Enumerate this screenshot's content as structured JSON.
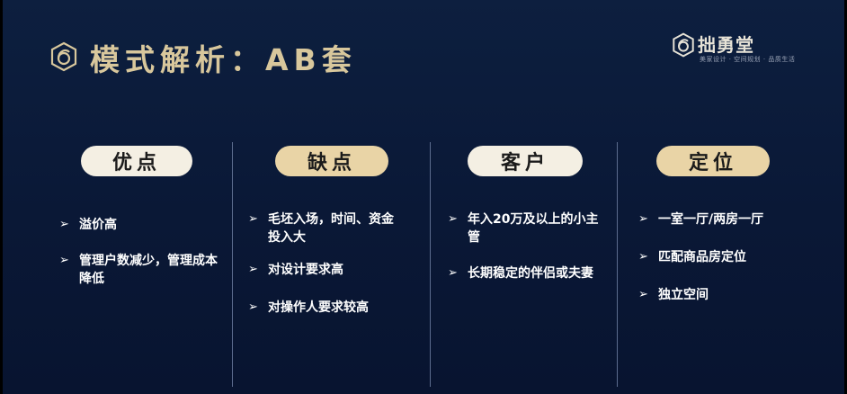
{
  "header": {
    "title": "模式解析：AB套",
    "brand_name": "拙勇堂",
    "brand_tagline": "美家设计 · 空间规划 · 品质生活"
  },
  "bullet_glyph": "➢",
  "columns": [
    {
      "heading": "优点",
      "items": [
        "溢价高",
        "管理户数减少，管理成本降低"
      ]
    },
    {
      "heading": "缺点",
      "items": [
        "毛坯入场，时间、资金投入大",
        "对设计要求高",
        "对操作人要求较高"
      ]
    },
    {
      "heading": "客户",
      "items": [
        "年入20万及以上的小主管",
        "长期稳定的伴侣或夫妻"
      ]
    },
    {
      "heading": "定位",
      "items": [
        "一室一厅/两房一厅",
        "匹配商品房定位",
        "独立空间"
      ]
    }
  ]
}
